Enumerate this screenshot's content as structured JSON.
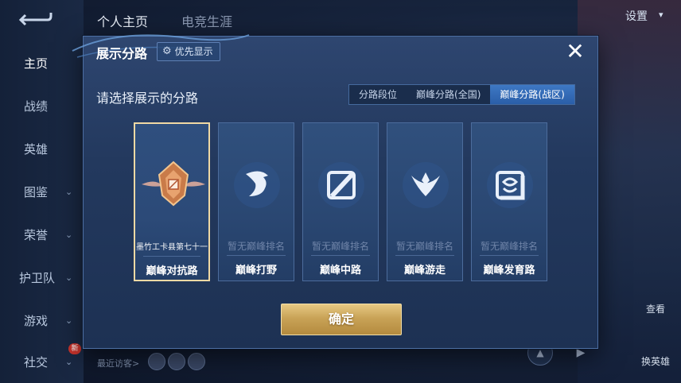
{
  "top_tabs": {
    "profile": "个人主页",
    "esports": "电竞生涯"
  },
  "settings_label": "设置",
  "left_nav": [
    {
      "label": "主页",
      "has_chevron": false
    },
    {
      "label": "战绩",
      "has_chevron": false
    },
    {
      "label": "英雄",
      "has_chevron": false
    },
    {
      "label": "图鉴",
      "has_chevron": true
    },
    {
      "label": "荣誉",
      "has_chevron": true
    },
    {
      "label": "护卫队",
      "has_chevron": true
    },
    {
      "label": "游戏",
      "has_chevron": true
    },
    {
      "label": "社交",
      "has_chevron": true
    }
  ],
  "new_badge": "新",
  "recent_visitors_label": "最近访客>",
  "right_buttons": {
    "strategy": "查看",
    "swap": "换英雄"
  },
  "modal": {
    "title": "展示分路",
    "priority_button": "优先显示",
    "subtitle": "请选择展示的分路",
    "segments": [
      "分路段位",
      "巅峰分路(全国)",
      "巅峰分路(战区)"
    ],
    "active_segment": 2,
    "cards": [
      {
        "rank": "墨竹工卡县第七十一",
        "label": "巅峰对抗路",
        "selected": true,
        "icon": "clash-lane-badge-icon"
      },
      {
        "rank": "暂无巅峰排名",
        "label": "巅峰打野",
        "selected": false,
        "icon": "jungle-dragon-icon"
      },
      {
        "rank": "暂无巅峰排名",
        "label": "巅峰中路",
        "selected": false,
        "icon": "mid-lane-icon"
      },
      {
        "rank": "暂无巅峰排名",
        "label": "巅峰游走",
        "selected": false,
        "icon": "roam-wings-icon"
      },
      {
        "rank": "暂无巅峰排名",
        "label": "巅峰发育路",
        "selected": false,
        "icon": "farm-lane-icon"
      }
    ],
    "confirm_label": "确定"
  },
  "colors": {
    "accent_gold": "#e0c07a",
    "selected_border": "#f0d9a4",
    "segment_active": "#3a73c0"
  }
}
